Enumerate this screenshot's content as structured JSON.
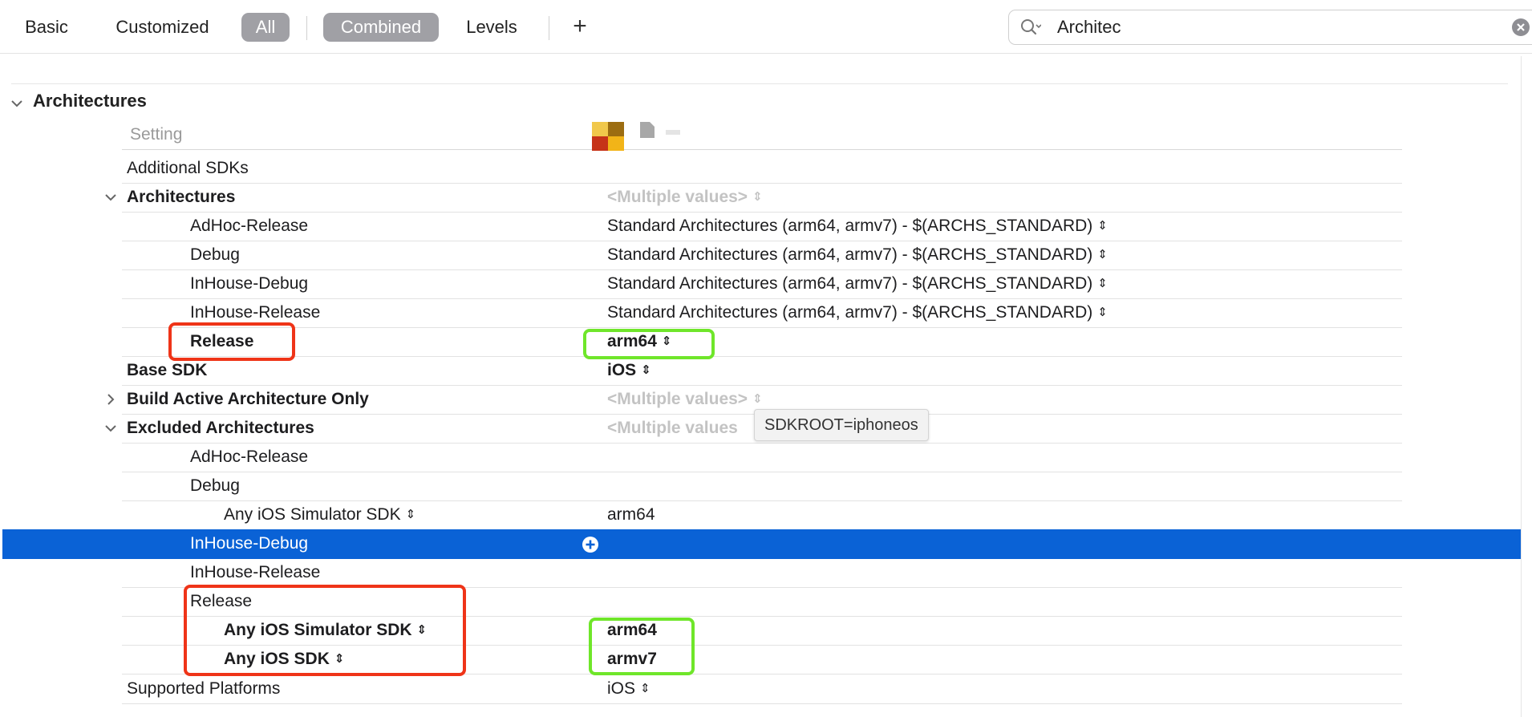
{
  "toolbar": {
    "basic": "Basic",
    "customized": "Customized",
    "all": "All",
    "combined": "Combined",
    "levels": "Levels",
    "add": "+",
    "search_value": "Architec"
  },
  "section": {
    "title": "Architectures"
  },
  "header": {
    "setting": "Setting"
  },
  "rows": {
    "additional_sdks": {
      "name": "Additional SDKs",
      "value": ""
    },
    "architectures": {
      "name": "Architectures",
      "value": "<Multiple values>"
    },
    "arch_adhoc": {
      "name": "AdHoc-Release",
      "value": "Standard Architectures (arm64, armv7)  -  $(ARCHS_STANDARD)"
    },
    "arch_debug": {
      "name": "Debug",
      "value": "Standard Architectures (arm64, armv7)  -  $(ARCHS_STANDARD)"
    },
    "arch_inhouse_debug": {
      "name": "InHouse-Debug",
      "value": "Standard Architectures (arm64, armv7)  -  $(ARCHS_STANDARD)"
    },
    "arch_inhouse_release": {
      "name": "InHouse-Release",
      "value": "Standard Architectures (arm64, armv7)  -  $(ARCHS_STANDARD)"
    },
    "arch_release": {
      "name": "Release",
      "value": "arm64"
    },
    "base_sdk": {
      "name": "Base SDK",
      "value": "iOS"
    },
    "build_active": {
      "name": "Build Active Architecture Only",
      "value": "<Multiple values>"
    },
    "excluded": {
      "name": "Excluded Architectures",
      "value": "<Multiple values"
    },
    "ex_adhoc": {
      "name": "AdHoc-Release",
      "value": ""
    },
    "ex_debug": {
      "name": "Debug",
      "value": ""
    },
    "ex_debug_sim": {
      "name": "Any iOS Simulator SDK",
      "value": "arm64"
    },
    "ex_inhouse_debug": {
      "name": "InHouse-Debug",
      "value": ""
    },
    "ex_inhouse_release": {
      "name": "InHouse-Release",
      "value": ""
    },
    "ex_release": {
      "name": "Release",
      "value": ""
    },
    "ex_release_sim": {
      "name": "Any iOS Simulator SDK",
      "value": "arm64"
    },
    "ex_release_sdk": {
      "name": "Any iOS SDK",
      "value": "armv7"
    },
    "supported_platforms": {
      "name": "Supported Platforms",
      "value": "iOS"
    }
  },
  "tooltip": "SDKROOT=iphoneos",
  "colors": {
    "selection": "#0a62d6",
    "annotation_red": "#ef3418",
    "annotation_green": "#6fe62a"
  }
}
